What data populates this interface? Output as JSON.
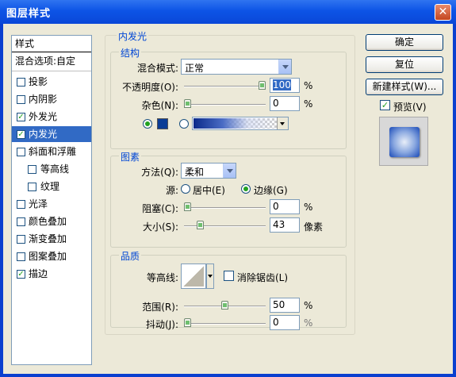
{
  "window": {
    "title": "图层样式"
  },
  "stylelist": {
    "header": "样式",
    "blend": "混合选项:自定",
    "items": [
      {
        "label": "投影",
        "checked": false
      },
      {
        "label": "内阴影",
        "checked": false
      },
      {
        "label": "外发光",
        "checked": true
      },
      {
        "label": "内发光",
        "checked": true,
        "selected": true
      },
      {
        "label": "斜面和浮雕",
        "checked": false
      },
      {
        "label": "等高线",
        "checked": false,
        "sub": true
      },
      {
        "label": "纹理",
        "checked": false,
        "sub": true
      },
      {
        "label": "光泽",
        "checked": false
      },
      {
        "label": "颜色叠加",
        "checked": false
      },
      {
        "label": "渐变叠加",
        "checked": false
      },
      {
        "label": "图案叠加",
        "checked": false
      },
      {
        "label": "描边",
        "checked": true
      }
    ]
  },
  "inner_glow": {
    "title": "内发光",
    "structure": {
      "title": "结构",
      "blend_mode_label": "混合模式:",
      "blend_mode_value": "正常",
      "opacity_label": "不透明度(O):",
      "opacity_value": "100",
      "noise_label": "杂色(N):",
      "noise_value": "0",
      "percent": "%",
      "opacity_level": 1.0,
      "noise_level": 0.0,
      "glow_color": "#0a3c96"
    },
    "elements": {
      "title": "图素",
      "method_label": "方法(Q):",
      "method_value": "柔和",
      "source_label": "源:",
      "source_center": "居中(E)",
      "source_edge": "边缘(G)",
      "choke_label": "阻塞(C):",
      "choke_value": "0",
      "size_label": "大小(S):",
      "size_value": "43",
      "size_unit": "像素",
      "percent": "%",
      "choke_level": 0.0,
      "size_level": 0.17
    },
    "quality": {
      "title": "品质",
      "contour_label": "等高线:",
      "antialias_label": "消除锯齿(L)",
      "range_label": "范围(R):",
      "range_value": "50",
      "jitter_label": "抖动(J):",
      "jitter_value": "0",
      "percent": "%",
      "range_level": 0.5,
      "jitter_level": 0.0
    }
  },
  "buttons": {
    "ok": "确定",
    "reset": "复位",
    "new_style": "新建样式(W)...",
    "preview": "预览(V)"
  },
  "icons": {
    "close": "close-icon",
    "check": "✓"
  }
}
